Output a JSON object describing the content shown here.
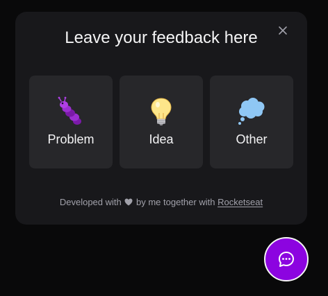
{
  "widget": {
    "title": "Leave your feedback here",
    "options": [
      {
        "label": "Problem",
        "icon": "caterpillar-bug-icon"
      },
      {
        "label": "Idea",
        "icon": "lightbulb-icon"
      },
      {
        "label": "Other",
        "icon": "thought-bubble-icon"
      }
    ],
    "footer": {
      "prefix": "Developed with",
      "middle": "by me together with",
      "link_text": "Rocketseat",
      "heart_icon": "heart-icon"
    },
    "close_icon": "close-icon"
  },
  "launcher": {
    "icon": "chat-bubble-icon"
  },
  "colors": {
    "background": "#09090a",
    "panel": "#18181b",
    "card": "#27272a",
    "accent": "#8c04e0",
    "text": "#f4f4f5",
    "muted": "#a1a1aa"
  }
}
